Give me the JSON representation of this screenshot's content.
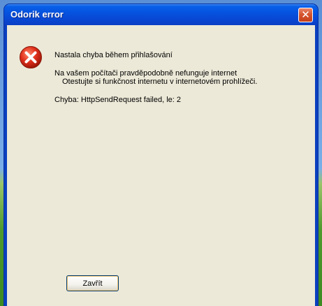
{
  "window": {
    "title": "Odorik error",
    "close_glyph": "✕"
  },
  "message": {
    "icon": "error-icon",
    "heading": "Nastala chyba během přihlašování",
    "line1": "Na vašem počítači pravděpodobně nefunguje internet",
    "line2": "Otestujte si funkčnost internetu v internetovém prohlížeči.",
    "error": "Chyba: HttpSendRequest failed, le: 2"
  },
  "buttons": {
    "close_label": "Zavřít"
  },
  "colors": {
    "titlebar": "#0553e0",
    "dialog_bg": "#ece9d8",
    "error_red": "#d42a1a"
  }
}
